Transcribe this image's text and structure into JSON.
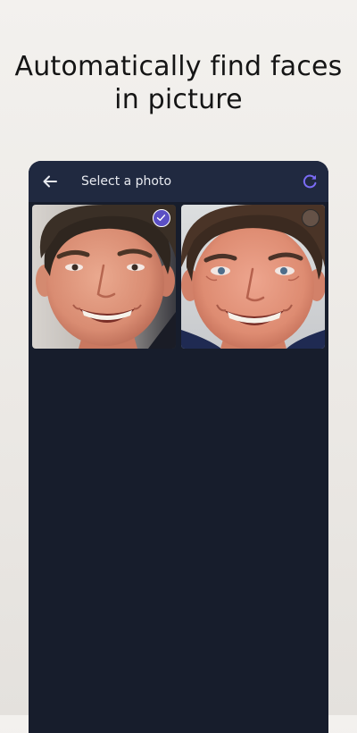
{
  "headline": {
    "line1": "Automatically find faces",
    "line2": "in picture"
  },
  "appbar": {
    "title": "Select a photo",
    "back_icon": "arrow-left-icon",
    "refresh_icon": "refresh-icon",
    "accent_color": "#7b6cf6"
  },
  "photos": [
    {
      "state": "selected",
      "badge_icon": "checkmark-icon"
    },
    {
      "state": "unselected",
      "badge_icon": "radio-unchecked-icon"
    }
  ],
  "colors": {
    "page_background": "#efece8",
    "app_background": "#171d2c",
    "appbar_background": "#202940",
    "selected_badge": "#5b4fc4"
  }
}
